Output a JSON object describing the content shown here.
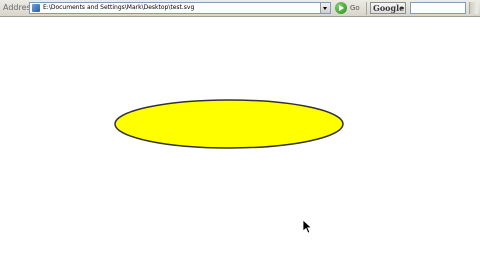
{
  "toolbar": {
    "address_label": "Address",
    "address_value": "E:\\Documents and Settings\\Mark\\Desktop\\test.svg",
    "go_label": "Go",
    "search_engine": "Google"
  },
  "document": {
    "ellipse_fill": "#ffff00",
    "ellipse_stroke": "#333333"
  },
  "icons": {
    "page": "document-icon",
    "go": "go-arrow-icon",
    "cursor": "mouse-pointer-icon"
  }
}
